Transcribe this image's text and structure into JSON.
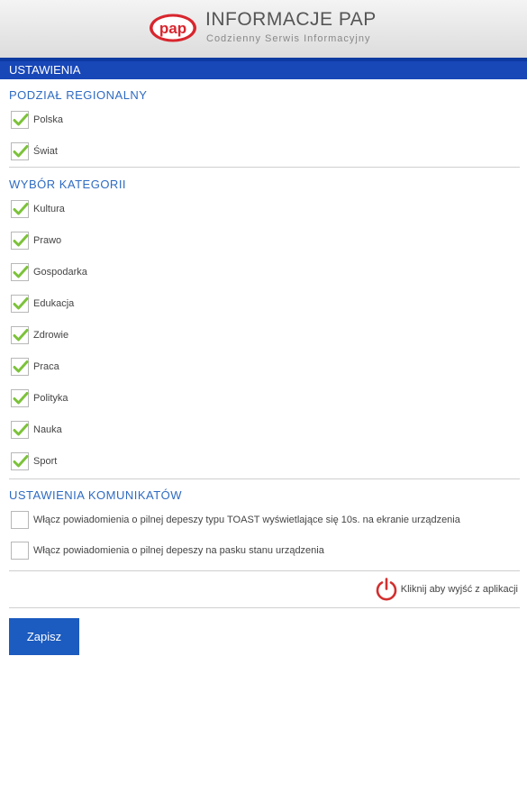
{
  "header": {
    "logo_text": "pap",
    "title": "INFORMACJE PAP",
    "subtitle": "Codzienny Serwis Informacyjny"
  },
  "settings_bar": {
    "label": "USTAWIENIA"
  },
  "regional": {
    "heading": "PODZIAŁ REGIONALNY",
    "items": [
      {
        "label": "Polska",
        "checked": true
      },
      {
        "label": "Świat",
        "checked": true
      }
    ]
  },
  "categories": {
    "heading": "WYBÓR KATEGORII",
    "items": [
      {
        "label": "Kultura",
        "checked": true
      },
      {
        "label": "Prawo",
        "checked": true
      },
      {
        "label": "Gospodarka",
        "checked": true
      },
      {
        "label": "Edukacja",
        "checked": true
      },
      {
        "label": "Zdrowie",
        "checked": true
      },
      {
        "label": "Praca",
        "checked": true
      },
      {
        "label": "Polityka",
        "checked": true
      },
      {
        "label": "Nauka",
        "checked": true
      },
      {
        "label": "Sport",
        "checked": true
      }
    ]
  },
  "notifications": {
    "heading": "USTAWIENIA KOMUNIKATÓW",
    "items": [
      {
        "label": "Włącz powiadomienia o pilnej depeszy typu TOAST wyświetlające się 10s. na ekranie urządzenia",
        "checked": false
      },
      {
        "label": "Włącz powiadomienia o pilnej depeszy na pasku stanu urządzenia",
        "checked": false
      }
    ]
  },
  "exit": {
    "label": "Kliknij aby wyjść z aplikacji",
    "icon": "power-icon"
  },
  "save_button": {
    "label": "Zapisz"
  },
  "colors": {
    "accent": "#1847b8",
    "heading": "#2e6bc2",
    "check": "#7cc23a",
    "logo_red": "#d8262e",
    "exit_red": "#d32f2f",
    "button": "#1c5bbf"
  }
}
